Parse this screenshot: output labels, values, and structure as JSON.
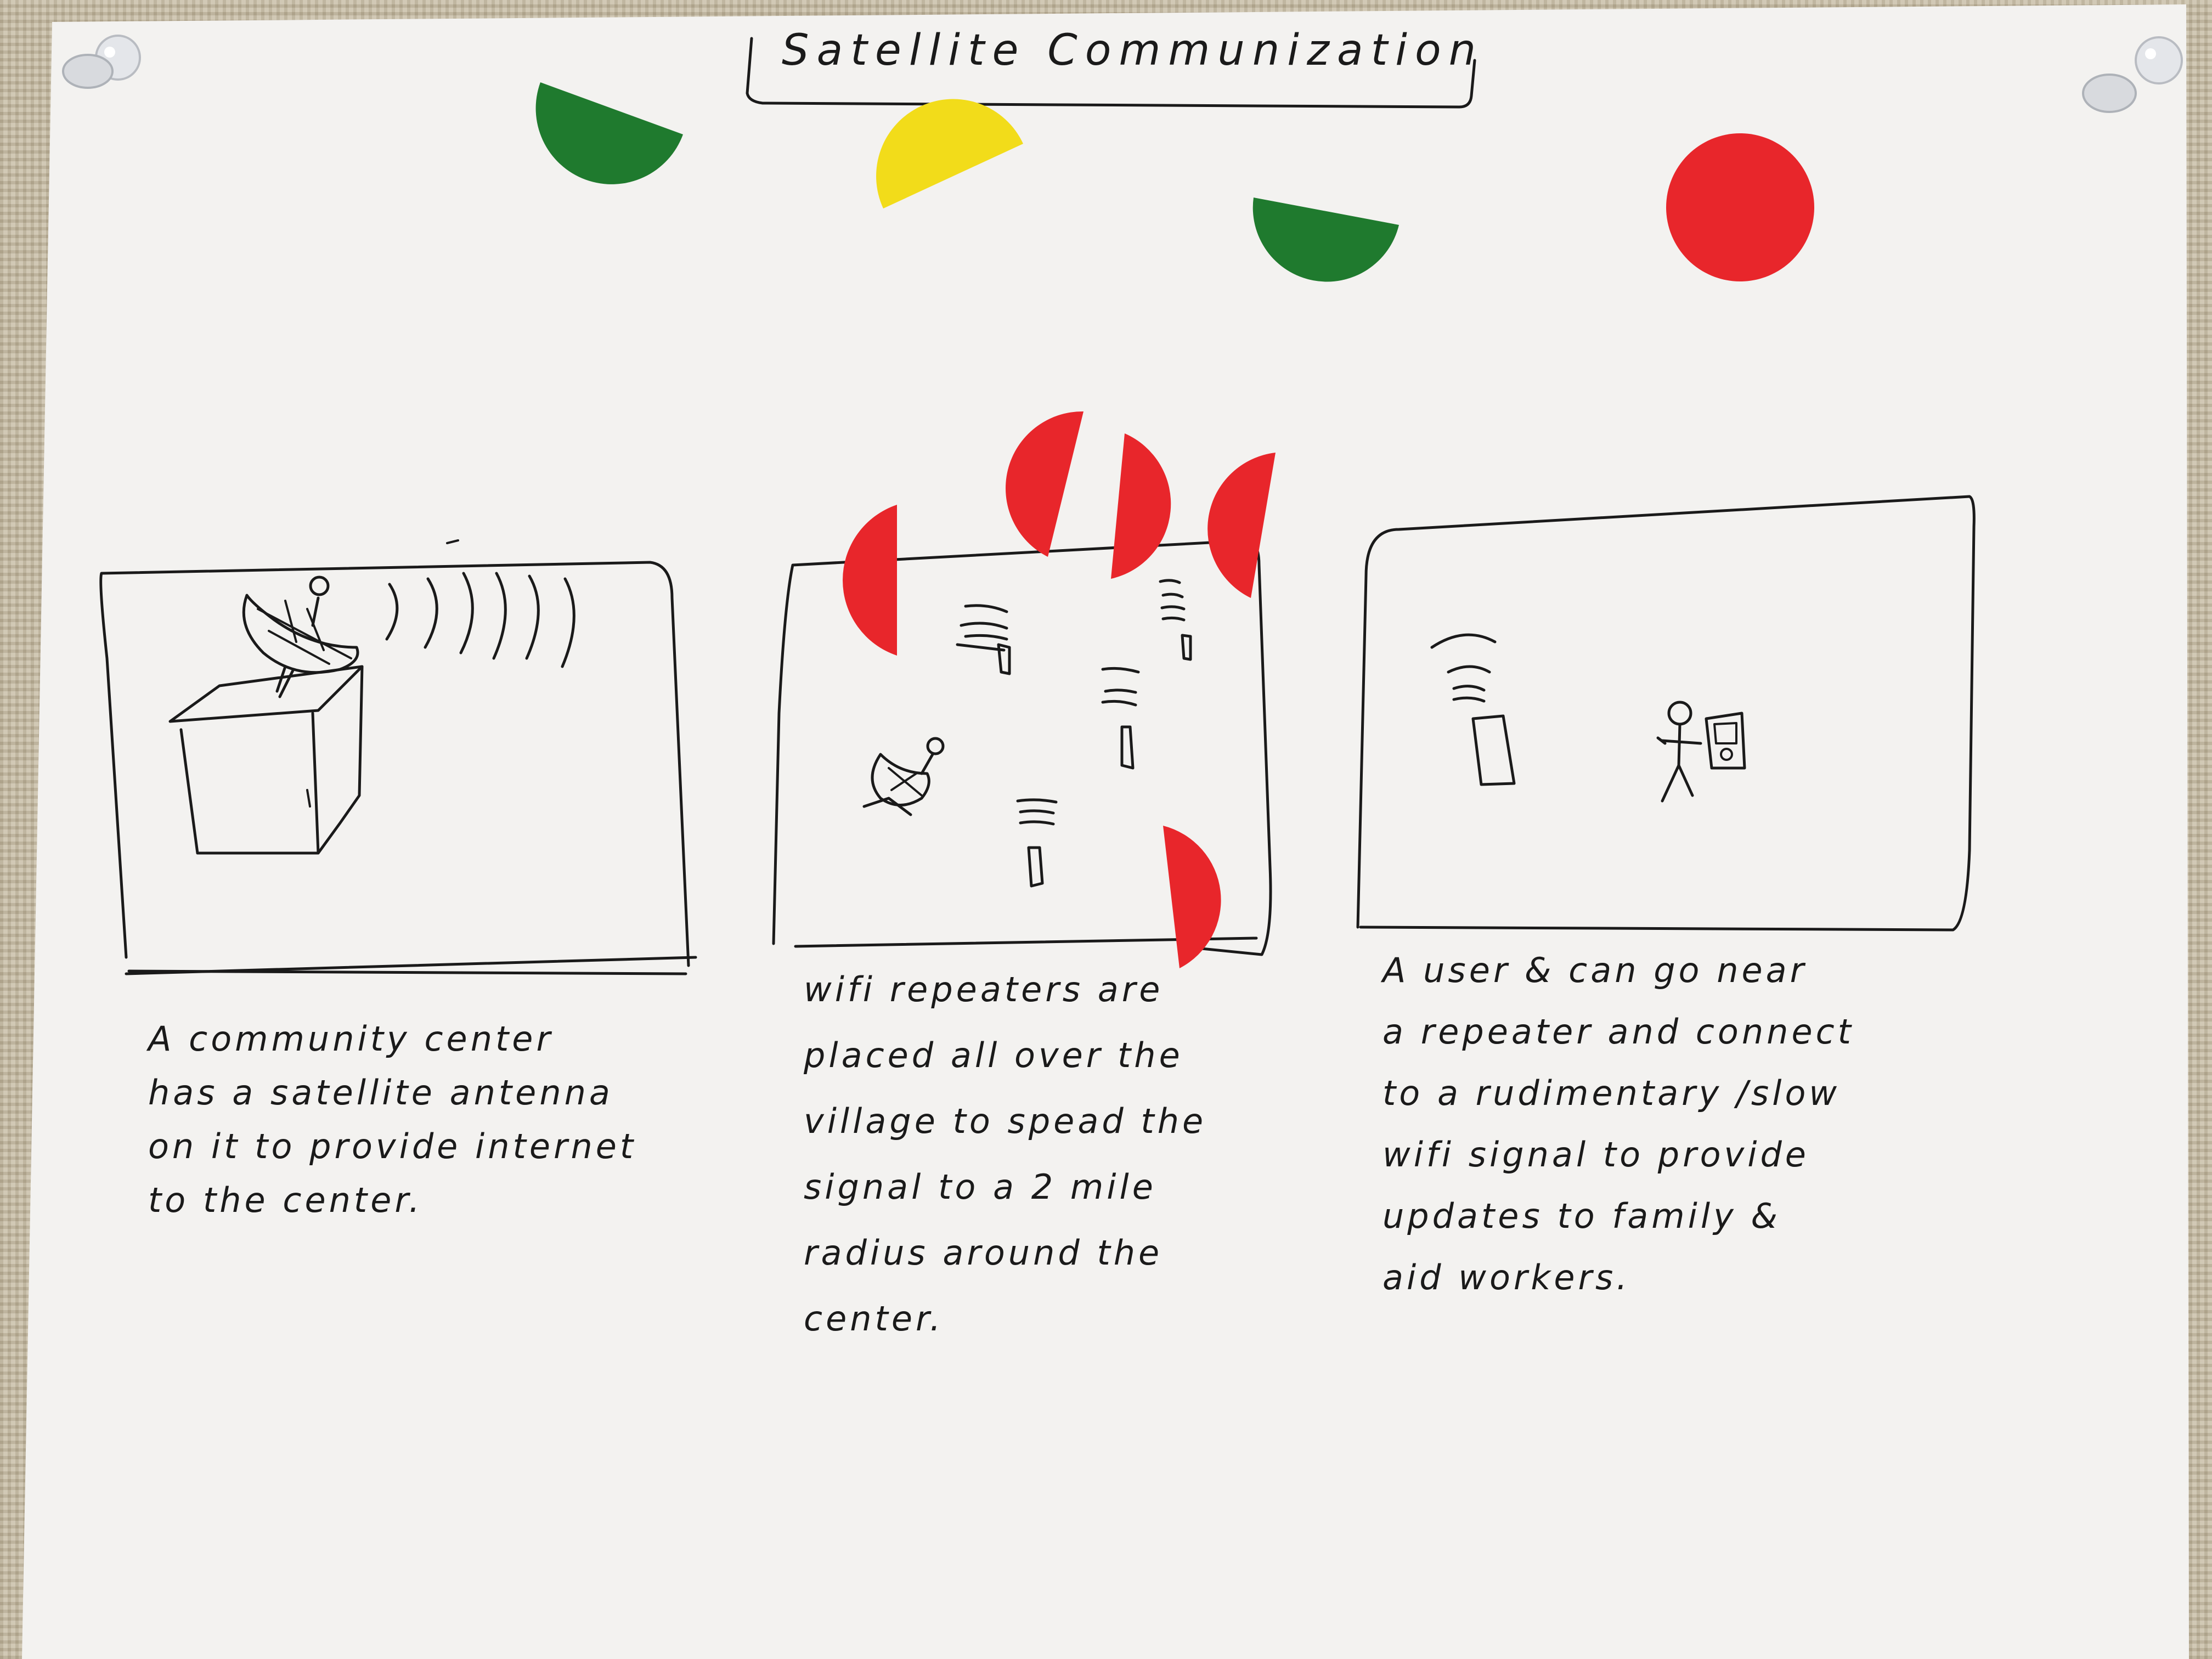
{
  "poster": {
    "title": "Satellite Communization",
    "paper_color": "#f3f2f0",
    "ink_color": "#1a1a1a"
  },
  "stickers": {
    "green": "#1f7a2e",
    "yellow": "#f2dc1a",
    "red": "#e8262b"
  },
  "panels": [
    {
      "caption_lines": [
        "A community center",
        "has a satellite antenna",
        "on it to provide internet",
        "to the center."
      ]
    },
    {
      "caption_lines": [
        "wifi repeaters are",
        "placed all over the",
        "village to spead the",
        "signal to a 2 mile",
        "radius around the",
        "center."
      ]
    },
    {
      "caption_lines": [
        "A user & can go near",
        "a repeater and connect",
        "to a rudimentary /slow",
        "wifi signal to provide",
        "updates to family &",
        "aid workers."
      ]
    }
  ]
}
